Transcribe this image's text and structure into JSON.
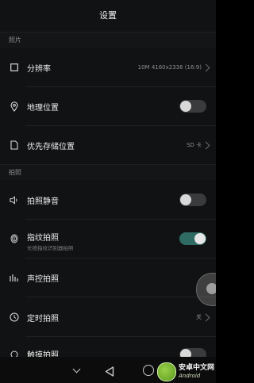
{
  "header": {
    "title": "设置"
  },
  "sections": {
    "photo": "照片",
    "shooting": "拍照"
  },
  "settings": {
    "resolution": {
      "label": "分辨率",
      "value": "10M 4160x2336 (16:9)",
      "icon": "crop-square-icon"
    },
    "location": {
      "label": "地理位置",
      "toggle": false,
      "icon": "location-pin-icon"
    },
    "storage": {
      "label": "优先存储位置",
      "value": "SD 卡",
      "icon": "document-icon"
    },
    "mute": {
      "label": "拍照静音",
      "toggle": false,
      "icon": "speaker-icon"
    },
    "fingerprint": {
      "label": "指纹拍照",
      "sublabel": "长按指纹识别器拍照",
      "toggle": true,
      "icon": "fingerprint-icon"
    },
    "voice": {
      "label": "声控拍照",
      "icon": "sound-bars-icon"
    },
    "timer": {
      "label": "定时拍照",
      "value": "关",
      "icon": "clock-icon"
    },
    "partial": {
      "label": "触摸拍照",
      "icon": "hand-icon"
    }
  },
  "navbar": {
    "buttons": [
      "down-arrow",
      "back",
      "home"
    ]
  },
  "watermark": {
    "cn": "安卓中文网",
    "en": "Android"
  },
  "colors": {
    "background": "#111213",
    "toggle_on": "#2f6a63",
    "toggle_off": "#3a3b3d"
  }
}
